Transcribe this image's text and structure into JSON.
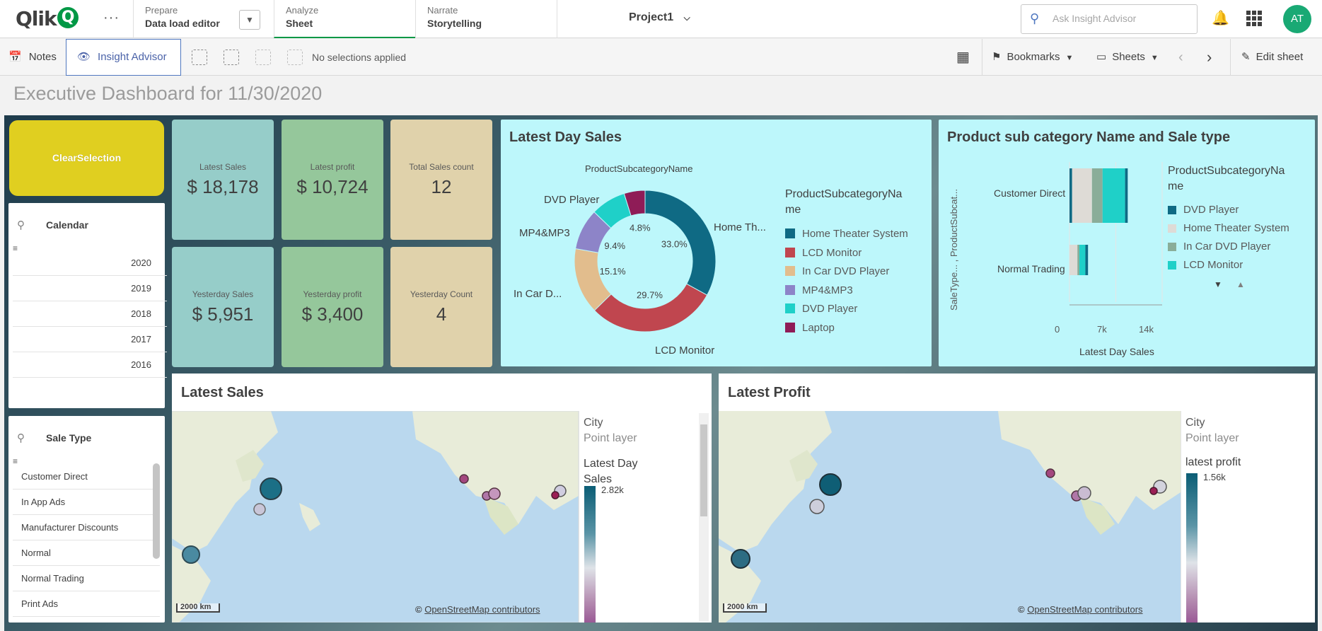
{
  "nav": {
    "logo_text": "Qlik",
    "logo_q": "Q",
    "more": "···",
    "prepare": {
      "small": "Prepare",
      "big": "Data load editor"
    },
    "analyze": {
      "small": "Analyze",
      "big": "Sheet"
    },
    "narrate": {
      "small": "Narrate",
      "big": "Storytelling"
    },
    "project": "Project1",
    "search_placeholder": "Ask Insight Advisor",
    "avatar": "AT"
  },
  "toolbar": {
    "notes": "Notes",
    "insight": "Insight Advisor",
    "selections": "No selections applied",
    "bookmarks": "Bookmarks",
    "sheets": "Sheets",
    "edit": "Edit sheet"
  },
  "page_title": "Executive Dashboard for 11/30/2020",
  "clear_button": "ClearSelection",
  "calendar": {
    "title": "Calendar",
    "items": [
      "2020",
      "2019",
      "2018",
      "2017",
      "2016"
    ]
  },
  "sale_type": {
    "title": "Sale Type",
    "items": [
      "Customer Direct",
      "In App Ads",
      "Manufacturer Discounts",
      "Normal",
      "Normal Trading",
      "Print Ads"
    ]
  },
  "kpis": [
    {
      "label": "Latest Sales",
      "value": "$ 18,178",
      "color": "#96cdc9"
    },
    {
      "label": "Latest profit",
      "value": "$ 10,724",
      "color": "#95c79b"
    },
    {
      "label": "Total Sales count",
      "value": "12",
      "color": "#e0d2ab"
    },
    {
      "label": "Yesterday Sales",
      "value": "$ 5,951",
      "color": "#96cdc9"
    },
    {
      "label": "Yesterday profit",
      "value": "$ 3,400",
      "color": "#95c79b"
    },
    {
      "label": "Yesterday Count",
      "value": "4",
      "color": "#e0d2ab"
    }
  ],
  "latest_day_sales": {
    "title": "Latest Day Sales",
    "dim_title": "ProductSubcategoryName",
    "legend_title_1": "ProductSubcategoryNa",
    "legend_title_2": "me",
    "outer_labels": {
      "home": "Home Th...",
      "lcd": "LCD Monitor",
      "incar": "In Car D...",
      "mp3": "MP4&MP3",
      "dvd": "DVD Player"
    },
    "legend": [
      {
        "name": "Home Theater System",
        "color": "#0f6a84"
      },
      {
        "name": "LCD Monitor",
        "color": "#c0464f"
      },
      {
        "name": "In Car DVD Player",
        "color": "#e2bd8d"
      },
      {
        "name": "MP4&MP3",
        "color": "#8d84c8"
      },
      {
        "name": "DVD Player",
        "color": "#1fd0c8"
      },
      {
        "name": "Laptop",
        "color": "#8f1c57"
      }
    ]
  },
  "chart_data": [
    {
      "type": "pie",
      "title": "Latest Day Sales",
      "categories": [
        "Home Theater System",
        "LCD Monitor",
        "In Car DVD Player",
        "MP4&MP3",
        "DVD Player",
        "Laptop"
      ],
      "values": [
        33.0,
        29.7,
        15.1,
        9.4,
        8.0,
        4.8
      ],
      "data_labels": [
        "33.0%",
        "29.7%",
        "15.1%",
        "9.4%",
        "",
        "4.8%"
      ]
    },
    {
      "type": "bar",
      "orientation": "horizontal",
      "stacked": true,
      "title": "Product sub category Name and Sale type",
      "categories": [
        "Customer Direct",
        "Normal Trading"
      ],
      "series": [
        {
          "name": "DVD Player",
          "values": [
            800,
            400
          ]
        },
        {
          "name": "Home Theater System",
          "values": [
            3000,
            1200
          ]
        },
        {
          "name": "In Car DVD Player",
          "values": [
            1600,
            300
          ]
        },
        {
          "name": "LCD Monitor",
          "values": [
            3400,
            900
          ]
        }
      ],
      "xlabel": "Latest Day Sales",
      "ylabel": "SaleType... , ProductSubcat...",
      "xlim": [
        0,
        14000
      ],
      "x_ticks": [
        "0",
        "7k",
        "14k"
      ]
    }
  ],
  "subcat_panel": {
    "title": "Product sub category Name and Sale type",
    "legend_title_1": "ProductSubcategoryNa",
    "legend_title_2": "me",
    "legend": [
      {
        "name": "DVD Player",
        "color": "#0f6a84"
      },
      {
        "name": "Home Theater System",
        "color": "#dedbd6"
      },
      {
        "name": "In Car DVD Player",
        "color": "#8aad99"
      },
      {
        "name": "LCD Monitor",
        "color": "#1fd0c8"
      }
    ],
    "y_axis": "SaleType... , ProductSubcat...",
    "cat1": "Customer Direct",
    "cat2": "Normal Trading",
    "ticks": [
      "0",
      "7k",
      "14k"
    ],
    "x_axis": "Latest Day Sales"
  },
  "map_sales": {
    "title": "Latest Sales",
    "layer_title": "City",
    "layer_sub": "Point layer",
    "measure_1": "Latest Day",
    "measure_2": "Sales",
    "max": "2.82k",
    "scale": "2000 km",
    "attr_prefix": "©",
    "attr_link": "OpenStreetMap contributors"
  },
  "map_profit": {
    "title": "Latest Profit",
    "layer_title": "City",
    "layer_sub": "Point layer",
    "measure_1": "latest profit",
    "max": "1.56k",
    "scale": "2000 km",
    "attr_prefix": "©",
    "attr_link": "OpenStreetMap contributors"
  }
}
